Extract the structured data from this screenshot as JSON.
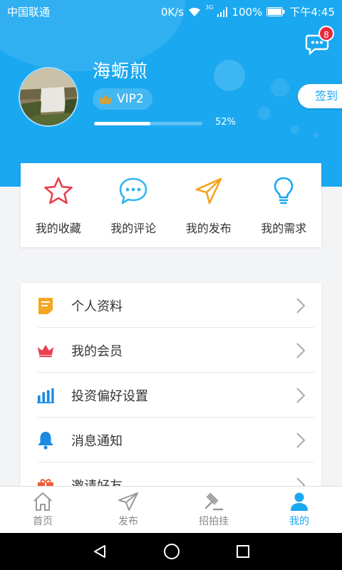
{
  "status_bar": {
    "carrier": "中国联通",
    "network_speed": "0K/s",
    "signal_label": "3G",
    "battery": "100%",
    "time": "下午4:45"
  },
  "header": {
    "message_badge": "8",
    "username": "海蛎煎",
    "vip_level": "VIP2",
    "progress": 52,
    "progress_text": "52%",
    "signin_label": "签到"
  },
  "quick_actions": [
    {
      "label": "我的收藏",
      "icon": "star-icon",
      "color": "#e8414f"
    },
    {
      "label": "我的评论",
      "icon": "chat-bubble-icon",
      "color": "#31b4f0"
    },
    {
      "label": "我的发布",
      "icon": "paper-plane-icon",
      "color": "#f5a223"
    },
    {
      "label": "我的需求",
      "icon": "lightbulb-icon",
      "color": "#1aa8f0"
    }
  ],
  "menu": [
    {
      "label": "个人资料",
      "icon": "document-icon",
      "color": "#f5a623"
    },
    {
      "label": "我的会员",
      "icon": "crown-icon",
      "color": "#e8414f"
    },
    {
      "label": "投资偏好设置",
      "icon": "bar-chart-icon",
      "color": "#1a8be0"
    },
    {
      "label": "消息通知",
      "icon": "bell-icon",
      "color": "#1a8be0"
    },
    {
      "label": "邀请好友",
      "icon": "gift-icon",
      "color": "#f05a3a"
    }
  ],
  "tabbar": [
    {
      "label": "首页",
      "icon": "home-icon",
      "active": false
    },
    {
      "label": "发布",
      "icon": "send-icon",
      "active": false
    },
    {
      "label": "招拍挂",
      "icon": "gavel-icon",
      "active": false
    },
    {
      "label": "我的",
      "icon": "user-icon",
      "active": true
    }
  ],
  "colors": {
    "primary": "#1aa8f0",
    "badge": "#e8283e"
  }
}
